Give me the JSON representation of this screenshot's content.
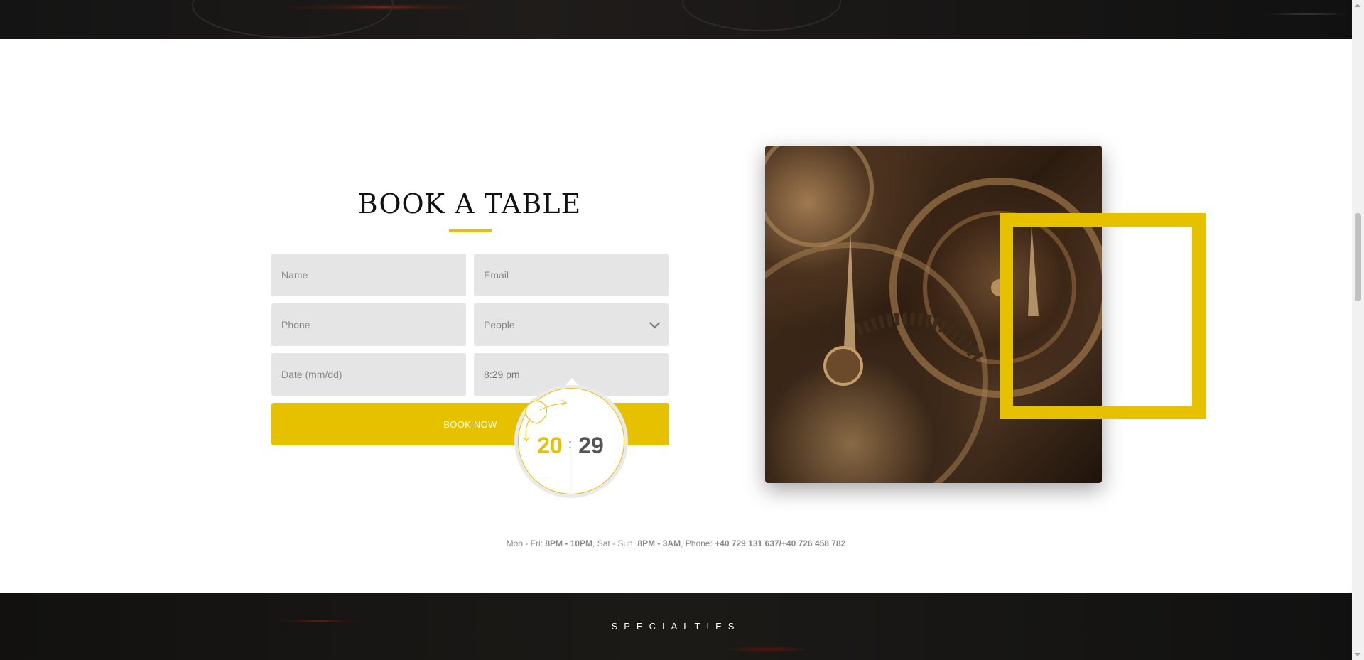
{
  "booking": {
    "title": "BOOK A TABLE",
    "fields": {
      "name_placeholder": "Name",
      "email_placeholder": "Email",
      "phone_placeholder": "Phone",
      "people_selected": "People",
      "date_placeholder": "Date (mm/dd)",
      "time_value": "8:29 pm"
    },
    "submit_label": "BOOK NOW"
  },
  "clock_picker": {
    "hours": "20",
    "separator": ":",
    "minutes": "29"
  },
  "info": {
    "weekday_label": "Mon - Fri: ",
    "weekday_hours": "8PM - 10PM",
    "weekend_label": ", Sat - Sun: ",
    "weekend_hours": "8PM - 3AM",
    "phone_label": ", Phone: ",
    "phone_numbers": "+40 729 131 637/+40 726 458 782"
  },
  "specialties": {
    "title": "SPECIALTIES"
  },
  "colors": {
    "accent": "#e6c100",
    "field_bg": "#e5e5e5"
  }
}
